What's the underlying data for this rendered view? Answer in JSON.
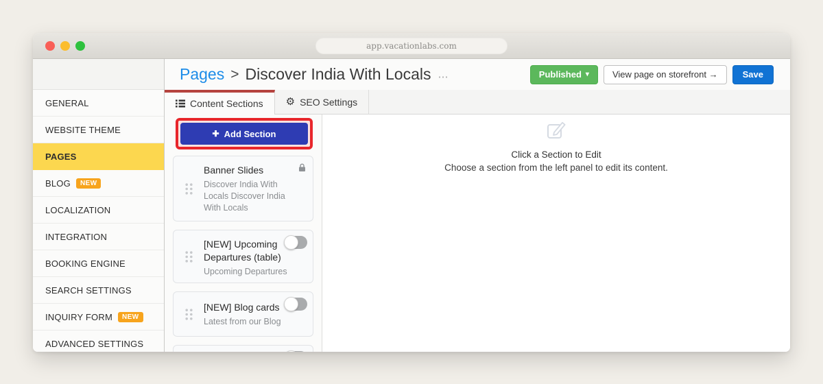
{
  "browser": {
    "url": "app.vacationlabs.com"
  },
  "header": {
    "breadcrumb_root": "Pages",
    "breadcrumb_separator": ">",
    "page_title": "Discover India With Locals",
    "title_ellipsis": "⋯",
    "buttons": {
      "published": "Published",
      "published_caret": "▾",
      "view_storefront": "View page on storefront →",
      "save": "Save"
    }
  },
  "sidebar": {
    "items": [
      {
        "label": "GENERAL"
      },
      {
        "label": "WEBSITE THEME"
      },
      {
        "label": "PAGES",
        "active": true
      },
      {
        "label": "BLOG",
        "badge": "NEW"
      },
      {
        "label": "LOCALIZATION"
      },
      {
        "label": "INTEGRATION"
      },
      {
        "label": "BOOKING ENGINE"
      },
      {
        "label": "SEARCH SETTINGS"
      },
      {
        "label": "INQUIRY FORM",
        "badge": "NEW"
      },
      {
        "label": "ADVANCED SETTINGS"
      }
    ]
  },
  "tabs": {
    "content_sections": "Content Sections",
    "seo_settings": "SEO Settings",
    "gear_glyph": "⚙"
  },
  "sections_panel": {
    "add_button": {
      "plus": "✚",
      "label": "Add Section"
    },
    "cards": [
      {
        "title": "Banner Slides",
        "subtitle": "Discover India With Locals Discover India With Locals",
        "locked": true
      },
      {
        "title": "[NEW] Upcoming Departures (table)",
        "subtitle": "Upcoming Departures",
        "toggle": "off"
      },
      {
        "title": "[NEW] Blog cards",
        "subtitle": "Latest from our Blog",
        "toggle": "off"
      },
      {
        "toggle": "off"
      }
    ]
  },
  "editor_panel": {
    "empty_title": "Click a Section to Edit",
    "empty_description": "Choose a section from the left panel to edit its content."
  },
  "colors": {
    "accent_blue": "#1173d4",
    "published_green": "#5cb85c",
    "add_section_indigo": "#2e3cb3",
    "active_nav_yellow": "#fcd74f",
    "new_badge_orange": "#f7a41d",
    "annotation_red": "#e8262b",
    "active_tab_red": "#b5433e"
  }
}
